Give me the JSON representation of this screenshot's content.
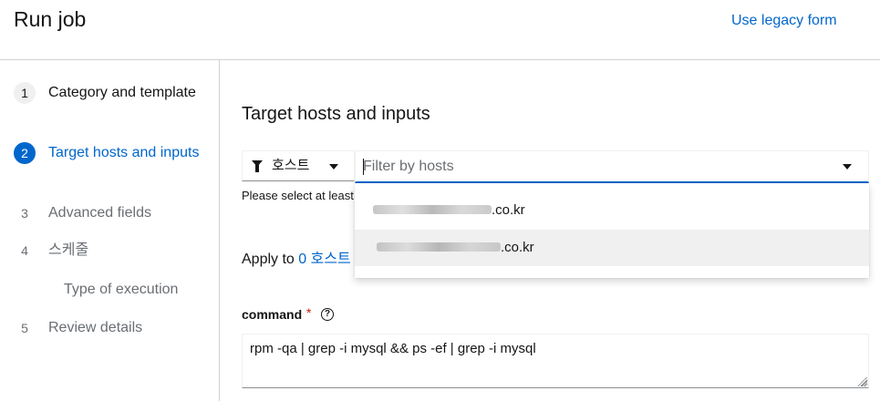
{
  "header": {
    "title": "Run job",
    "legacy_link": "Use legacy form"
  },
  "nav": {
    "steps": [
      {
        "num": "1",
        "label": "Category and template",
        "state": "visited"
      },
      {
        "num": "2",
        "label": "Target hosts and inputs",
        "state": "current"
      },
      {
        "num": "3",
        "label": "Advanced fields",
        "state": "pending"
      },
      {
        "num": "4",
        "label": "스케줄",
        "state": "pending"
      },
      {
        "num": "5",
        "label": "Review details",
        "state": "pending"
      }
    ],
    "substep": "Type of execution"
  },
  "main": {
    "section_title": "Target hosts and inputs",
    "filter": {
      "type_label": "호스트",
      "icon": "filter-icon",
      "input_value": "",
      "placeholder": "Filter by hosts"
    },
    "helper_text": "Please select at least one host",
    "dropdown": {
      "items": [
        {
          "suffix": ".co.kr",
          "blurred": true
        },
        {
          "suffix": ".co.kr",
          "blurred": true
        }
      ],
      "hovered_index": 1
    },
    "apply": {
      "prefix": "Apply to",
      "count_link": "0 호스트"
    },
    "command": {
      "label": "command",
      "required_mark": "*",
      "help_icon": "?",
      "value": "rpm -qa | grep -i mysql && ps -ef | grep -i mysql"
    }
  },
  "colors": {
    "accent": "#0066cc",
    "required": "#c9190b",
    "border": "#d2d2d2"
  }
}
